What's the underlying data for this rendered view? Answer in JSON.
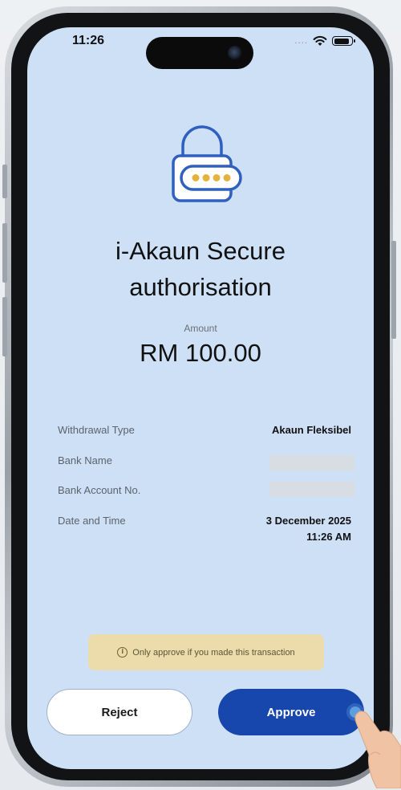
{
  "status_bar": {
    "time": "11:26",
    "signal": "....",
    "wifi_icon": "wifi-icon",
    "battery_icon": "battery-icon"
  },
  "header": {
    "icon": "padlock-password-icon",
    "title": "i-Akaun Secure authorisation"
  },
  "amount": {
    "label": "Amount",
    "value": "RM 100.00"
  },
  "details": [
    {
      "label": "Withdrawal Type",
      "value": "Akaun Fleksibel"
    },
    {
      "label": "Bank Name",
      "value": ""
    },
    {
      "label": "Bank Account No.",
      "value": ""
    },
    {
      "label": "Date and Time",
      "value_line1": "3 December 2025",
      "value_line2": "11:26 AM"
    }
  ],
  "notice": {
    "icon": "info-icon",
    "text": "Only approve if you made this transaction"
  },
  "actions": {
    "reject_label": "Reject",
    "approve_label": "Approve"
  },
  "colors": {
    "screen_bg": "#cde0f6",
    "primary": "#1746ad",
    "notice_bg": "#ecdcac",
    "lock_gold": "#e5b33d",
    "lock_blue": "#2f5fbf"
  }
}
